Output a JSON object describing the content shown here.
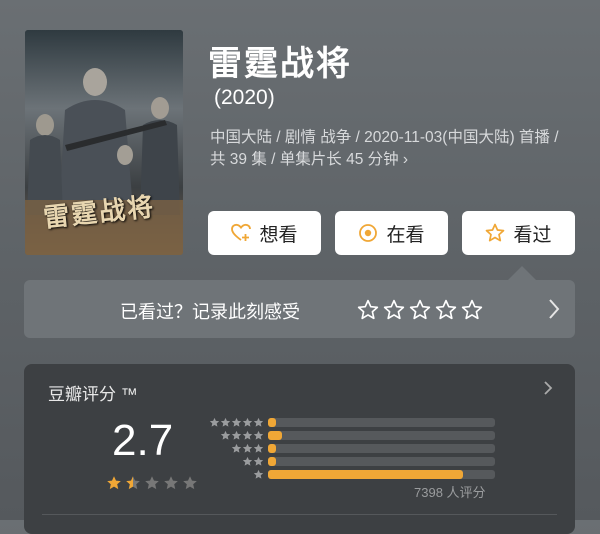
{
  "movie": {
    "title": "雷霆战将",
    "year": "(2020)",
    "meta": "中国大陆 / 剧情 战争 / 2020-11-03(中国大陆) 首播 / 共 39 集 / 单集片长 45 分钟 ›",
    "poster_text": "雷霆战将"
  },
  "actions": {
    "want": "想看",
    "watching": "在看",
    "watched": "看过"
  },
  "record": {
    "prompt": "已看过？记录此刻感受"
  },
  "rating": {
    "title": "豆瓣评分 ™",
    "score": "2.7",
    "count": "7398 人评分",
    "star_fraction": 0.27,
    "distribution": [
      0.02,
      0.06,
      0.03,
      0.03,
      0.86
    ]
  },
  "colors": {
    "accent": "#f0a736",
    "background": "#5f6468"
  }
}
